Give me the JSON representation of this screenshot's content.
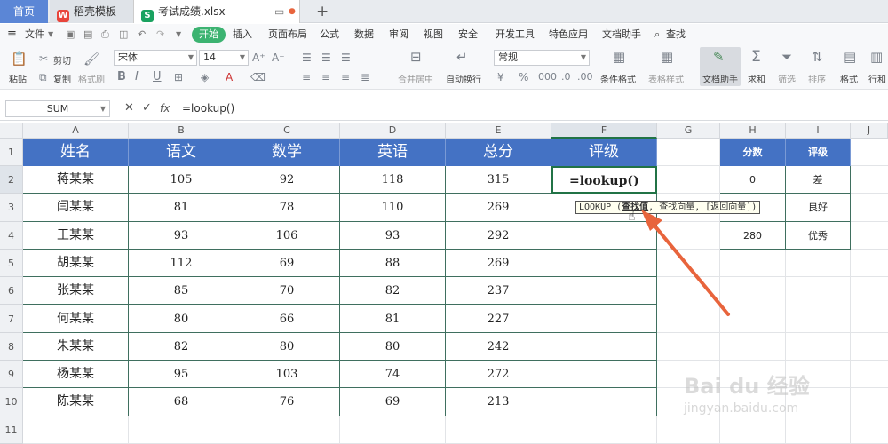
{
  "tabs": {
    "home": "首页",
    "template": "稻壳模板",
    "file": "考试成绩.xlsx"
  },
  "menu": {
    "file": "文件",
    "start": "开始",
    "insert": "插入",
    "layout": "页面布局",
    "formula": "公式",
    "data": "数据",
    "review": "审阅",
    "view": "视图",
    "security": "安全",
    "dev": "开发工具",
    "special": "特色应用",
    "doc_helper": "文档助手",
    "search": "查找"
  },
  "ribbon": {
    "paste": "粘贴",
    "cut": "剪切",
    "copy": "复制",
    "format_painter": "格式刷",
    "font": "宋体",
    "font_size": "14",
    "merge": "合并居中",
    "wrap": "自动换行",
    "number_format": "常规",
    "cond_format": "条件格式",
    "table_style": "表格样式",
    "doc_helper": "文档助手",
    "sum": "求和",
    "filter": "筛选",
    "sort": "排序",
    "format": "格式",
    "rowcol": "行和"
  },
  "formula_bar": {
    "name_box": "SUM",
    "fx": "fx",
    "formula": "=lookup()"
  },
  "columns": [
    "A",
    "B",
    "C",
    "D",
    "E",
    "F",
    "G",
    "H",
    "I",
    "J"
  ],
  "rows": [
    "1",
    "2",
    "3",
    "4",
    "5",
    "6",
    "7",
    "8",
    "9",
    "10",
    "11"
  ],
  "table": {
    "headers": [
      "姓名",
      "语文",
      "数学",
      "英语",
      "总分",
      "评级"
    ],
    "rows": [
      [
        "蒋某某",
        "105",
        "92",
        "118",
        "315"
      ],
      [
        "闫某某",
        "81",
        "78",
        "110",
        "269"
      ],
      [
        "王某某",
        "93",
        "106",
        "93",
        "292"
      ],
      [
        "胡某某",
        "112",
        "69",
        "88",
        "269"
      ],
      [
        "张某某",
        "85",
        "70",
        "82",
        "237"
      ],
      [
        "何某某",
        "80",
        "66",
        "81",
        "227"
      ],
      [
        "朱某某",
        "82",
        "80",
        "80",
        "242"
      ],
      [
        "杨某某",
        "95",
        "103",
        "74",
        "272"
      ],
      [
        "陈某某",
        "68",
        "76",
        "69",
        "213"
      ]
    ],
    "editing_cell": "=lookup()"
  },
  "lookup_table": {
    "headers": [
      "分数",
      "评级"
    ],
    "rows": [
      [
        "0",
        "差"
      ],
      [
        "",
        "良好"
      ],
      [
        "280",
        "优秀"
      ]
    ]
  },
  "tooltip": {
    "func": "LOOKUP (",
    "arg": "查找值",
    "rest": ", 查找向量, [返回向量])"
  },
  "watermark": {
    "brand": "Bai du 经验",
    "url": "jingyan.baidu.com"
  },
  "colors": {
    "header_blue": "#4472c4",
    "cell_border": "#3f6f5f",
    "active_green": "#217346",
    "arrow": "#e8643c"
  }
}
